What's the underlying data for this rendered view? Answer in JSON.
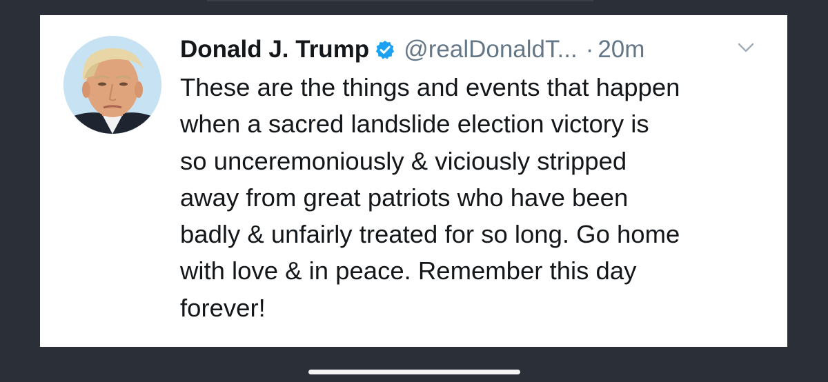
{
  "tweet": {
    "display_name": "Donald J. Trump",
    "handle": "@realDonaldT...",
    "separator": "·",
    "timestamp": "20m",
    "verified": true,
    "text_lines": [
      "These are the things and events that happen",
      "when a sacred landslide election victory is",
      "so unceremoniously & viciously stripped",
      "away from great patriots who have been",
      "badly & unfairly treated for so long. Go home",
      "with love & in peace. Remember this day",
      "forever!"
    ]
  },
  "icons": {
    "verified": "verified-badge-icon",
    "menu": "chevron-down-icon",
    "avatar": "avatar"
  },
  "colors": {
    "background": "#2b3038",
    "card": "#ffffff",
    "text": "#14171a",
    "secondary_text": "#657786",
    "verified_blue": "#1da1f2"
  }
}
